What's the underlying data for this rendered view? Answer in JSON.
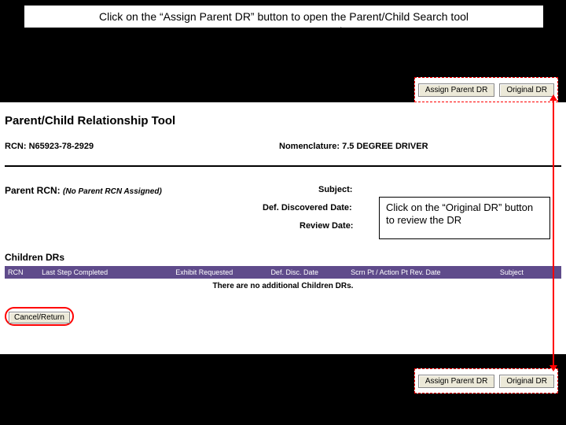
{
  "instruction_top": "Click on the “Assign Parent DR” button to open the Parent/Child Search tool",
  "buttons": {
    "assign_parent": "Assign Parent DR",
    "original_dr": "Original DR",
    "cancel_return": "Cancel/Return"
  },
  "tool_title": "Parent/Child Relationship Tool",
  "rcn": {
    "label": "RCN:",
    "value": "N65923-78-2929"
  },
  "nomenclature": {
    "label": "Nomenclature:",
    "value": "7.5 DEGREE DRIVER"
  },
  "parent_rcn": {
    "label": "Parent RCN:",
    "value": "(No Parent RCN Assigned)"
  },
  "field_labels": {
    "subject": "Subject:",
    "def_discovered": "Def. Discovered Date:",
    "review_date": "Review Date:"
  },
  "callout_original": "Click on the “Original DR” button to review the DR",
  "children": {
    "title": "Children DRs",
    "columns": [
      "RCN",
      "Last Step Completed",
      "Exhibit Requested",
      "Def. Disc. Date",
      "Scrn Pt / Action Pt Rev. Date",
      "Subject"
    ],
    "empty_message": "There are no additional Children DRs."
  }
}
